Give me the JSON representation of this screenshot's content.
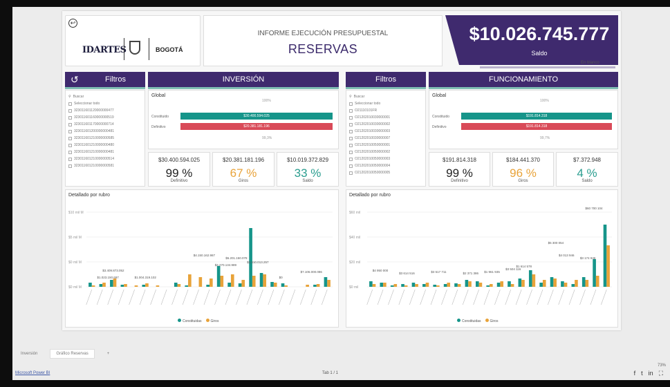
{
  "header": {
    "logo_idartes": "IDARTES",
    "logo_bogota": "BOGOTÁ",
    "title_line1": "INFORME EJECUCIÓN PRESUPUESTAL",
    "title_line2": "RESERVAS",
    "saldo_amount": "$10.026.745.777",
    "saldo_label": "Saldo",
    "saldo_note": "En blanco"
  },
  "inversion": {
    "filter_label": "Filtros",
    "section_label": "INVERSIÓN",
    "search_placeholder": "Buscar",
    "select_all": "Seleccionar todo",
    "filter_items": [
      "323011601120000000477",
      "323011601160000000519",
      "323011601170000000714",
      "323011601200000000481",
      "323011601210000000585",
      "323011601210000000480",
      "323011601210000000481",
      "323011601210000000514",
      "323011601210000000581"
    ],
    "global_label": "Global",
    "top_pct": "100%",
    "bar1_label": "Constituido",
    "bar1_value": "$30.400.594.025",
    "bar2_label": "Definitivo",
    "bar2_value": "$20.381.181.196",
    "bottom_pct": "99,3%",
    "kpis": [
      {
        "amount": "$30.400.594.025",
        "pct": "99 %",
        "label": "Definitivo",
        "color": "#222222"
      },
      {
        "amount": "$20.381.181.196",
        "pct": "67 %",
        "label": "Giros",
        "color": "#e8a33a"
      },
      {
        "amount": "$10.019.372.829",
        "pct": "33 %",
        "label": "Saldo",
        "color": "#2a9d8f"
      }
    ],
    "chart_title": "Detallado por rubro",
    "y_ticks": [
      "$10 mil M",
      "$5 mil M",
      "$0 mil M",
      "$0 mil M"
    ],
    "data_labels": [
      "$3.409.873.052",
      "$1.023.150.697",
      "$1.004.319.102",
      "$0",
      "$4.150.162.987",
      "$4.270.134.989",
      "$6.201.150.078",
      "$3.410.013.257",
      "$7.106.000.086"
    ],
    "legend": [
      "Constituidas",
      "Giros"
    ]
  },
  "funcionamiento": {
    "filter_label": "Filtros",
    "section_label": "FUNCIONAMIENTO",
    "search_placeholder": "Buscar",
    "select_all": "Seleccionar todo",
    "filter_items": [
      "O21110101FR",
      "O21202010030000001",
      "O21202010030000002",
      "O21202010030000003",
      "O21202010030000007",
      "O21202010050000001",
      "O21202010050000002",
      "O21202010050000003",
      "O21202010050000004",
      "O21202010050000005"
    ],
    "global_label": "Global",
    "top_pct": "100%",
    "bar1_label": "Constituido",
    "bar1_value": "$191.814.318",
    "bar2_label": "Definitivo",
    "bar2_value": "$191.814.318",
    "bottom_pct": "99,7%",
    "kpis": [
      {
        "amount": "$191.814.318",
        "pct": "99 %",
        "label": "Definitivo",
        "color": "#222222"
      },
      {
        "amount": "$184.441.370",
        "pct": "96 %",
        "label": "Giros",
        "color": "#e8a33a"
      },
      {
        "amount": "$7.372.948",
        "pct": "4 %",
        "label": "Saldo",
        "color": "#2a9d8f"
      }
    ],
    "chart_title": "Detallado por rubro",
    "y_ticks": [
      "$60 mil",
      "$40 mil",
      "$20 mil",
      "$0 mil"
    ],
    "data_labels": [
      "$4 950 000",
      "$3 614 516",
      "$3 517 711",
      "$2 371 386",
      "$1 961 935",
      "$3 504 116",
      "$1 614 578",
      "$5 300 054",
      "$4 013 946",
      "$3 174 946",
      "$60 700 104"
    ],
    "legend": [
      "Constituidas",
      "Giros"
    ]
  },
  "tabs": {
    "tab1": "Inversión",
    "tab2": "Gráfico Reservas",
    "add": "+"
  },
  "status": {
    "left": "Microsoft Power BI",
    "center": "Tab 1 / 1",
    "zoom": "73%"
  },
  "colors": {
    "brand_purple": "#3f2a6e",
    "teal": "#16958a",
    "red": "#d94a58",
    "orange": "#e8a33a"
  }
}
